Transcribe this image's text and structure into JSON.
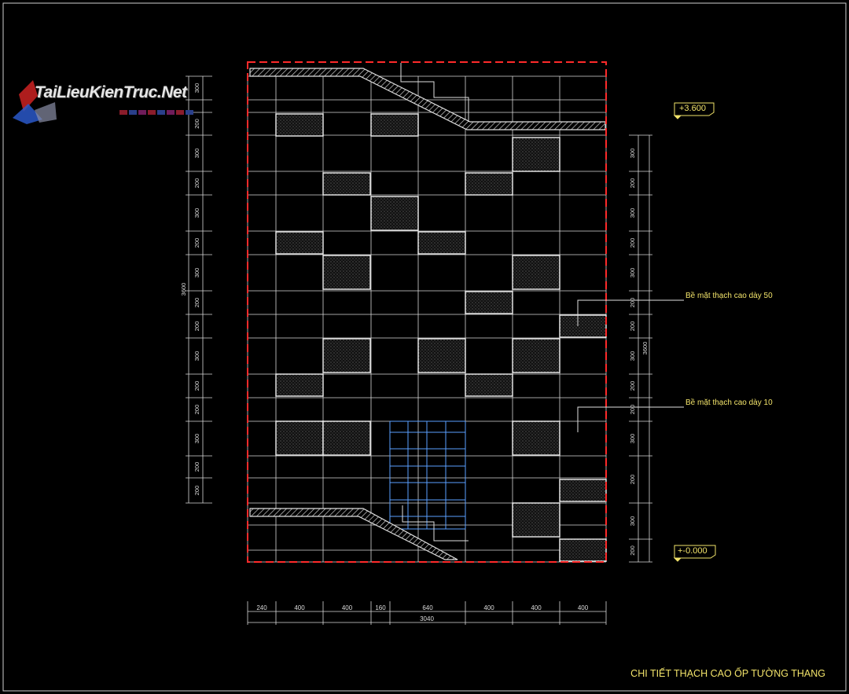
{
  "logo": {
    "text": "TaiLieuKienTruc.Net"
  },
  "title": "CHI TIẾT THẠCH CAO ỐP TƯỜNG THANG",
  "levels": {
    "top": "+3.600",
    "bottom": "+-0.000"
  },
  "notes": {
    "panel_50": "Bề mặt thạch cao dày 50",
    "panel_10": "Bề mặt thạch cao dày 10"
  },
  "dims": {
    "bottom": [
      "240",
      "400",
      "400",
      "160",
      "640",
      "400",
      "400",
      "400"
    ],
    "bottom_total": "3040",
    "left": [
      "300",
      "200",
      "300",
      "200",
      "300",
      "200",
      "300",
      "200",
      "200",
      "300",
      "200",
      "200",
      "300",
      "200",
      "200"
    ],
    "left_total": "3600",
    "right": [
      "300",
      "200",
      "300",
      "200",
      "300",
      "200",
      "200",
      "300",
      "200",
      "200",
      "300",
      "200",
      "300",
      "200"
    ],
    "right_total": "3600"
  },
  "colors": {
    "background": "#000000",
    "line": "#d9d9d9",
    "boundary": "#ff2a2a",
    "text": "#f2e36a",
    "tile": "#5aa0ff"
  }
}
